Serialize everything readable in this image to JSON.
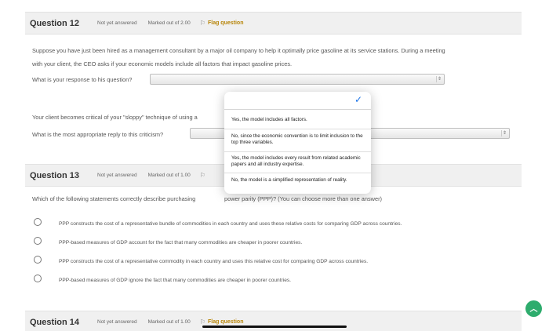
{
  "q12": {
    "title": "Question 12",
    "status": "Not yet answered",
    "marks": "Marked out of 2.00",
    "flag": "Flag question",
    "text_line1": "Suppose you have just been hired as a management consultant by a major oil company to help it optimally price gasoline at its service stations. During a meeting",
    "text_line2": "with your client, the CEO asks if your economic models include all factors that impact gasoline prices.",
    "prompt1": "What is your response to his question?",
    "text_line3": "Your client becomes critical of your \"sloppy\" technique of using a",
    "prompt2": "What is the most appropriate reply to this criticism?"
  },
  "dropdown_popup": {
    "options": [
      "Yes, the model includes all factors.",
      "No, since the economic convention is to limit inclusion to the top three variables.",
      "Yes, the model includes every result from related academic papers and all industry expertise.",
      "No, the model is a simplified representation of reality."
    ]
  },
  "q13": {
    "title": "Question 13",
    "status": "Not yet answered",
    "marks": "Marked out of 1.00",
    "question": "Which of the following statements correctly describe purchasing power parity (PPP)? (You can choose more than one answer)",
    "question_visible_tail": "power parity (PPP)? (You can choose more than one answer)",
    "question_visible_head": "Which of the following statements correctly describe purchasing",
    "options": [
      "PPP constructs the cost of a representative bundle of commodities in each country and uses these relative costs for comparing GDP across countries.",
      "PPP-based measures of GDP account for the fact that many commodities are cheaper in poorer countries.",
      "PPP constructs the cost of a representative commodity in each country and uses this relative cost for comparing GDP across countries.",
      "PPP-based measures of GDP ignore the fact that many commodities are cheaper in poorer countries."
    ]
  },
  "q14": {
    "title": "Question 14",
    "status": "Not yet answered",
    "marks": "Marked out of 1.00",
    "flag": "Flag question"
  },
  "colors": {
    "flag_text": "#b8860b",
    "check": "#1a73e8",
    "scroll_button": "#2eac6d"
  },
  "icons": {
    "flag": "flag-icon",
    "check": "checkmark-icon",
    "scroll_top": "chevron-up-icon"
  }
}
